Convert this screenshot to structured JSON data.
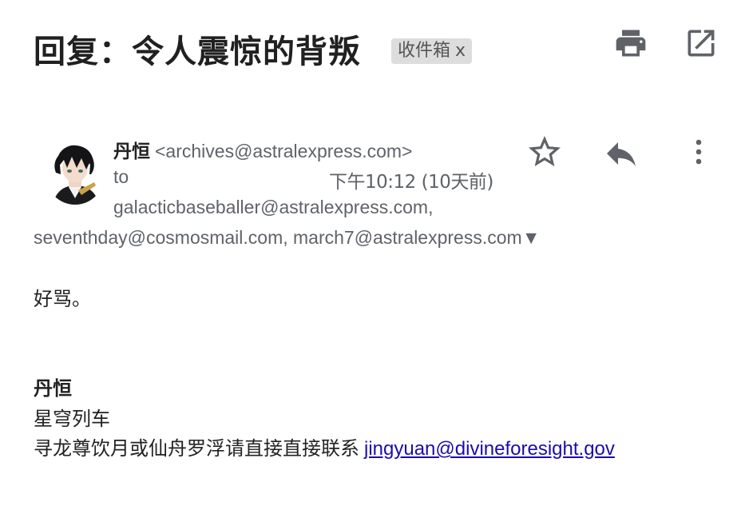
{
  "email": {
    "subject": "回复：令人震惊的背叛",
    "label": "收件箱",
    "label_remove": "x",
    "sender_name": "丹恒",
    "sender_email": "<archives@astralexpress.com>",
    "to_label": "to",
    "time": "下午10:12 (10天前)",
    "recipients_line1": "galacticbaseballer@astralexpress.com,",
    "recipients_line2": "seventhday@cosmosmail.com, march7@astralexpress.com",
    "expand_glyph": "▼",
    "body": "好骂。",
    "signature": {
      "name": "丹恒",
      "org": "星穹列车",
      "contact_text": "寻龙尊饮月或仙舟罗浮请直接直接联系",
      "contact_link": "jingyuan@divineforesight.gov"
    }
  },
  "icons": {
    "print": "print-icon",
    "popout": "open-in-new-window-icon",
    "star": "star-outline-icon",
    "reply": "reply-arrow-icon",
    "more": "more-vertical-icon",
    "avatar": "sender-avatar"
  },
  "colors": {
    "icon_gray": "#5f6368",
    "chip_bg": "#dddddd",
    "link": "#1a0dab"
  }
}
